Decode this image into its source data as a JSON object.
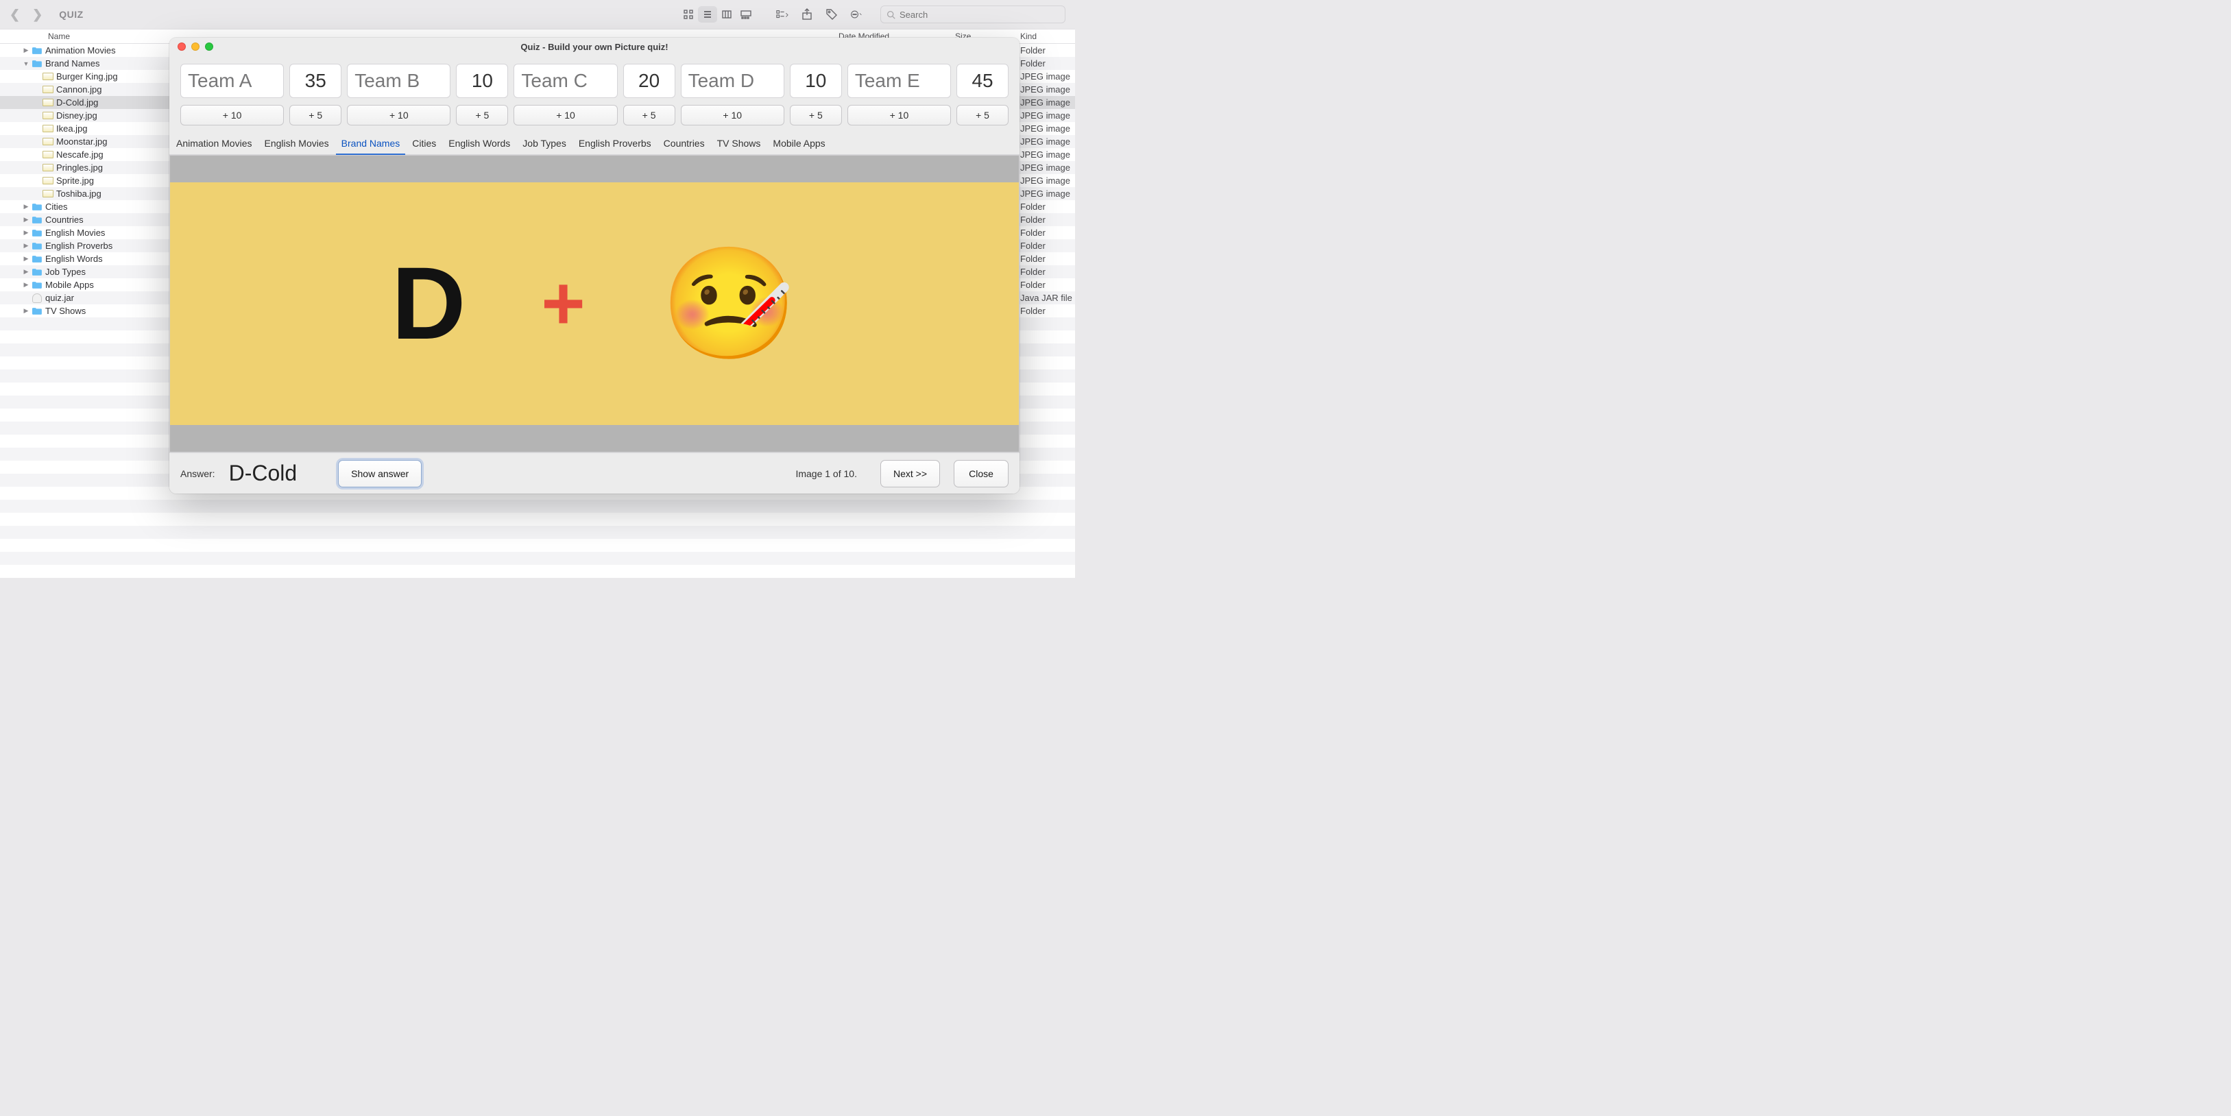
{
  "finder": {
    "title": "QUIZ",
    "search_placeholder": "Search",
    "headers": {
      "name": "Name",
      "date": "Date Modified",
      "size": "Size",
      "kind": "Kind"
    },
    "rows": [
      {
        "name": "Animation Movies",
        "kind": "Folder",
        "type": "folder",
        "indent": 0,
        "disclosure": "closed"
      },
      {
        "name": "Brand Names",
        "kind": "Folder",
        "type": "folder",
        "indent": 0,
        "disclosure": "open"
      },
      {
        "name": "Burger King.jpg",
        "kind": "JPEG image",
        "type": "jpeg",
        "indent": 1
      },
      {
        "name": "Cannon.jpg",
        "kind": "JPEG image",
        "type": "jpeg",
        "indent": 1
      },
      {
        "name": "D-Cold.jpg",
        "kind": "JPEG image",
        "type": "jpeg",
        "indent": 1,
        "selected": true
      },
      {
        "name": "Disney.jpg",
        "kind": "JPEG image",
        "type": "jpeg",
        "indent": 1
      },
      {
        "name": "Ikea.jpg",
        "kind": "JPEG image",
        "type": "jpeg",
        "indent": 1
      },
      {
        "name": "Moonstar.jpg",
        "kind": "JPEG image",
        "type": "jpeg",
        "indent": 1
      },
      {
        "name": "Nescafe.jpg",
        "kind": "JPEG image",
        "type": "jpeg",
        "indent": 1
      },
      {
        "name": "Pringles.jpg",
        "kind": "JPEG image",
        "type": "jpeg",
        "indent": 1
      },
      {
        "name": "Sprite.jpg",
        "kind": "JPEG image",
        "type": "jpeg",
        "indent": 1
      },
      {
        "name": "Toshiba.jpg",
        "kind": "JPEG image",
        "type": "jpeg",
        "indent": 1
      },
      {
        "name": "Cities",
        "kind": "Folder",
        "type": "folder",
        "indent": 0,
        "disclosure": "closed"
      },
      {
        "name": "Countries",
        "kind": "Folder",
        "type": "folder",
        "indent": 0,
        "disclosure": "closed"
      },
      {
        "name": "English Movies",
        "kind": "Folder",
        "type": "folder",
        "indent": 0,
        "disclosure": "closed"
      },
      {
        "name": "English Proverbs",
        "kind": "Folder",
        "type": "folder",
        "indent": 0,
        "disclosure": "closed"
      },
      {
        "name": "English Words",
        "kind": "Folder",
        "type": "folder",
        "indent": 0,
        "disclosure": "closed"
      },
      {
        "name": "Job Types",
        "kind": "Folder",
        "type": "folder",
        "indent": 0,
        "disclosure": "closed"
      },
      {
        "name": "Mobile Apps",
        "kind": "Folder",
        "type": "folder",
        "indent": 0,
        "disclosure": "closed"
      },
      {
        "name": "quiz.jar",
        "kind": "Java JAR file",
        "type": "jar",
        "indent": 0
      },
      {
        "name": "TV Shows",
        "kind": "Folder",
        "type": "folder",
        "indent": 0,
        "disclosure": "closed"
      }
    ]
  },
  "quiz": {
    "title": "Quiz - Build your own Picture quiz!",
    "teams": [
      {
        "name": "Team A",
        "score": "35"
      },
      {
        "name": "Team B",
        "score": "10"
      },
      {
        "name": "Team C",
        "score": "20"
      },
      {
        "name": "Team D",
        "score": "10"
      },
      {
        "name": "Team E",
        "score": "45"
      }
    ],
    "plus10": "+ 10",
    "plus5": "+ 5",
    "categories": [
      "Animation Movies",
      "English Movies",
      "Brand Names",
      "Cities",
      "English Words",
      "Job Types",
      "English Proverbs",
      "Countries",
      "TV Shows",
      "Mobile Apps"
    ],
    "active_category_index": 2,
    "picture": {
      "letter": "D",
      "plus": "+",
      "emoji": "🤒"
    },
    "answer_label": "Answer:",
    "answer_value": "D-Cold",
    "show_answer": "Show answer",
    "pager": "Image 1 of 10.",
    "next": "Next >>",
    "close": "Close"
  }
}
